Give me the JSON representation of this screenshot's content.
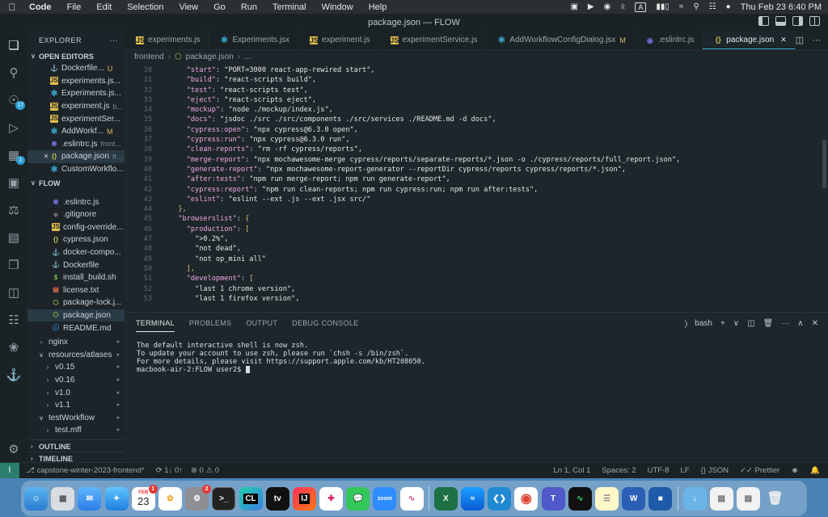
{
  "menubar": {
    "items": [
      "Code",
      "File",
      "Edit",
      "Selection",
      "View",
      "Go",
      "Run",
      "Terminal",
      "Window",
      "Help"
    ],
    "input_source": "A",
    "datetime": "Thu Feb 23  6:40 PM"
  },
  "window": {
    "title": "package.json — FLOW"
  },
  "activity": {
    "source_control_badge": "17",
    "extensions_badge": "1"
  },
  "explorer": {
    "header": "EXPLORER",
    "open_editors_label": "OPEN EDITORS",
    "open_editors": [
      {
        "name": "Dockerfile...",
        "git": "U",
        "icon": "docker"
      },
      {
        "name": "experiments.js...",
        "icon": "js"
      },
      {
        "name": "Experiments.js...",
        "icon": "react"
      },
      {
        "name": "experiment.js",
        "desc": "b...",
        "icon": "js"
      },
      {
        "name": "experimentSer...",
        "icon": "js"
      },
      {
        "name": "AddWorkf...",
        "git": "M",
        "icon": "react"
      },
      {
        "name": ".eslintrc.js",
        "desc": "front...",
        "icon": "eslint"
      },
      {
        "name": "package.json",
        "desc": "fr...",
        "icon": "json"
      },
      {
        "name": "CustomWorkflo...",
        "icon": "react"
      }
    ],
    "flow_label": "FLOW",
    "flow_files": [
      {
        "name": ".eslintrc.js",
        "icon": "eslint"
      },
      {
        "name": ".gitignore",
        "icon": "git"
      },
      {
        "name": "config-override...",
        "icon": "js"
      },
      {
        "name": "cypress.json",
        "icon": "json"
      },
      {
        "name": "docker-compo...",
        "icon": "docker"
      },
      {
        "name": "Dockerfile",
        "icon": "docker"
      },
      {
        "name": "install_build.sh",
        "icon": "sh"
      },
      {
        "name": "license.txt",
        "icon": "lic"
      },
      {
        "name": "package-lock.j...",
        "icon": "node"
      },
      {
        "name": "package.json",
        "icon": "node"
      },
      {
        "name": "README.md",
        "icon": "md"
      }
    ],
    "folders": [
      {
        "name": "nginx",
        "level": 0,
        "open": false
      },
      {
        "name": "resources/atlases",
        "level": 0,
        "open": true
      },
      {
        "name": "v0.15",
        "level": 1,
        "open": false
      },
      {
        "name": "v0.16",
        "level": 1,
        "open": false
      },
      {
        "name": "v1.0",
        "level": 1,
        "open": false
      },
      {
        "name": "v1.1",
        "level": 1,
        "open": false
      },
      {
        "name": "testWorkflow",
        "level": 0,
        "open": true
      },
      {
        "name": "test.mff",
        "level": 1,
        "open": false
      }
    ],
    "outline_label": "OUTLINE",
    "timeline_label": "TIMELINE"
  },
  "tabs": [
    {
      "label": "experiments.js",
      "icon": "js"
    },
    {
      "label": "Experiments.jsx",
      "icon": "react"
    },
    {
      "label": "experiment.js",
      "icon": "js"
    },
    {
      "label": "experimentService.js",
      "icon": "js"
    },
    {
      "label": "AddWorkflowConfigDialog.jsx",
      "icon": "react",
      "mod": "M"
    },
    {
      "label": ".eslintrc.js",
      "icon": "eslint"
    },
    {
      "label": "package.json",
      "icon": "json",
      "active": true
    }
  ],
  "breadcrumb": [
    "frontend",
    "package.json"
  ],
  "code": [
    {
      "n": "30",
      "k": "\"start\"",
      "v": "\"PORT=3000 react-app-rewired start\","
    },
    {
      "n": "31",
      "k": "\"build\"",
      "v": "\"react-scripts build\","
    },
    {
      "n": "32",
      "k": "\"test\"",
      "v": "\"react-scripts test\","
    },
    {
      "n": "33",
      "k": "\"eject\"",
      "v": "\"react-scripts eject\","
    },
    {
      "n": "34",
      "k": "\"mockup\"",
      "v": "\"node ./mockup/index.js\","
    },
    {
      "n": "35",
      "k": "\"docs\"",
      "v": "\"jsdoc ./src ./src/components ./src/services ./README.md -d docs\","
    },
    {
      "n": "36",
      "k": "\"cypress:open\"",
      "v": "\"npx cypress@6.3.0 open\","
    },
    {
      "n": "37",
      "k": "\"cypress:run\"",
      "v": "\"npx cypress@6.3.0 run\","
    },
    {
      "n": "38",
      "k": "\"clean-reports\"",
      "v": "\"rm -rf cypress/reports\","
    },
    {
      "n": "39",
      "k": "\"merge-report\"",
      "v": "\"npx mochawesome-merge cypress/reports/separate-reports/*.json -o ./cypress/reports/full_report.json\","
    },
    {
      "n": "40",
      "k": "\"generate-report\"",
      "v": "\"npx mochawesome-report-generator --reportDir cypress/reports cypress/reports/*.json\","
    },
    {
      "n": "41",
      "k": "\"after:tests\"",
      "v": "\"npm run merge-report; npm run generate-report\","
    },
    {
      "n": "42",
      "k": "\"cypress:report\"",
      "v": "\"npm run clean-reports; npm run cypress:run; npm run after:tests\","
    },
    {
      "n": "43",
      "k": "\"eslint\"",
      "v": "\"eslint --ext .js --ext .jsx src/\""
    },
    {
      "n": "44",
      "raw": "  },"
    },
    {
      "n": "45",
      "k": "\"browserslist\"",
      "v": "{",
      "indent": 1
    },
    {
      "n": "46",
      "k": "\"production\"",
      "v": "[",
      "indent": 2
    },
    {
      "n": "47",
      "raw": "      \">0.2%\","
    },
    {
      "n": "48",
      "raw": "      \"not dead\","
    },
    {
      "n": "49",
      "raw": "      \"not op_mini all\""
    },
    {
      "n": "50",
      "raw": "    ],"
    },
    {
      "n": "51",
      "k": "\"development\"",
      "v": "[",
      "indent": 2
    },
    {
      "n": "52",
      "raw": "      \"last 1 chrome version\","
    },
    {
      "n": "53",
      "raw": "      \"last 1 firefox version\","
    }
  ],
  "panel": {
    "tabs": [
      "TERMINAL",
      "PROBLEMS",
      "OUTPUT",
      "DEBUG CONSOLE"
    ],
    "shell": "bash",
    "terminal_lines": [
      "The default interactive shell is now zsh.",
      "To update your account to use zsh, please run `chsh -s /bin/zsh`.",
      "For more details, please visit https://support.apple.com/kb/HT208050.",
      "macbook-air-2:FLOW user2$ "
    ]
  },
  "status": {
    "branch": "capstone-winter-2023-frontend*",
    "sync": "1↓ 0↑",
    "errors": "0",
    "warnings": "0",
    "position": "Ln 1, Col 1",
    "spaces": "Spaces: 2",
    "encoding": "UTF-8",
    "eol": "LF",
    "language": "JSON",
    "formatter": "Prettier"
  },
  "dock": {
    "calendar_month": "FEB",
    "calendar_day": "23",
    "calendar_badge": "1",
    "settings_badge": "2",
    "zoom_label": "zoom",
    "clion_label": "CL",
    "intellij_label": "IJ"
  }
}
